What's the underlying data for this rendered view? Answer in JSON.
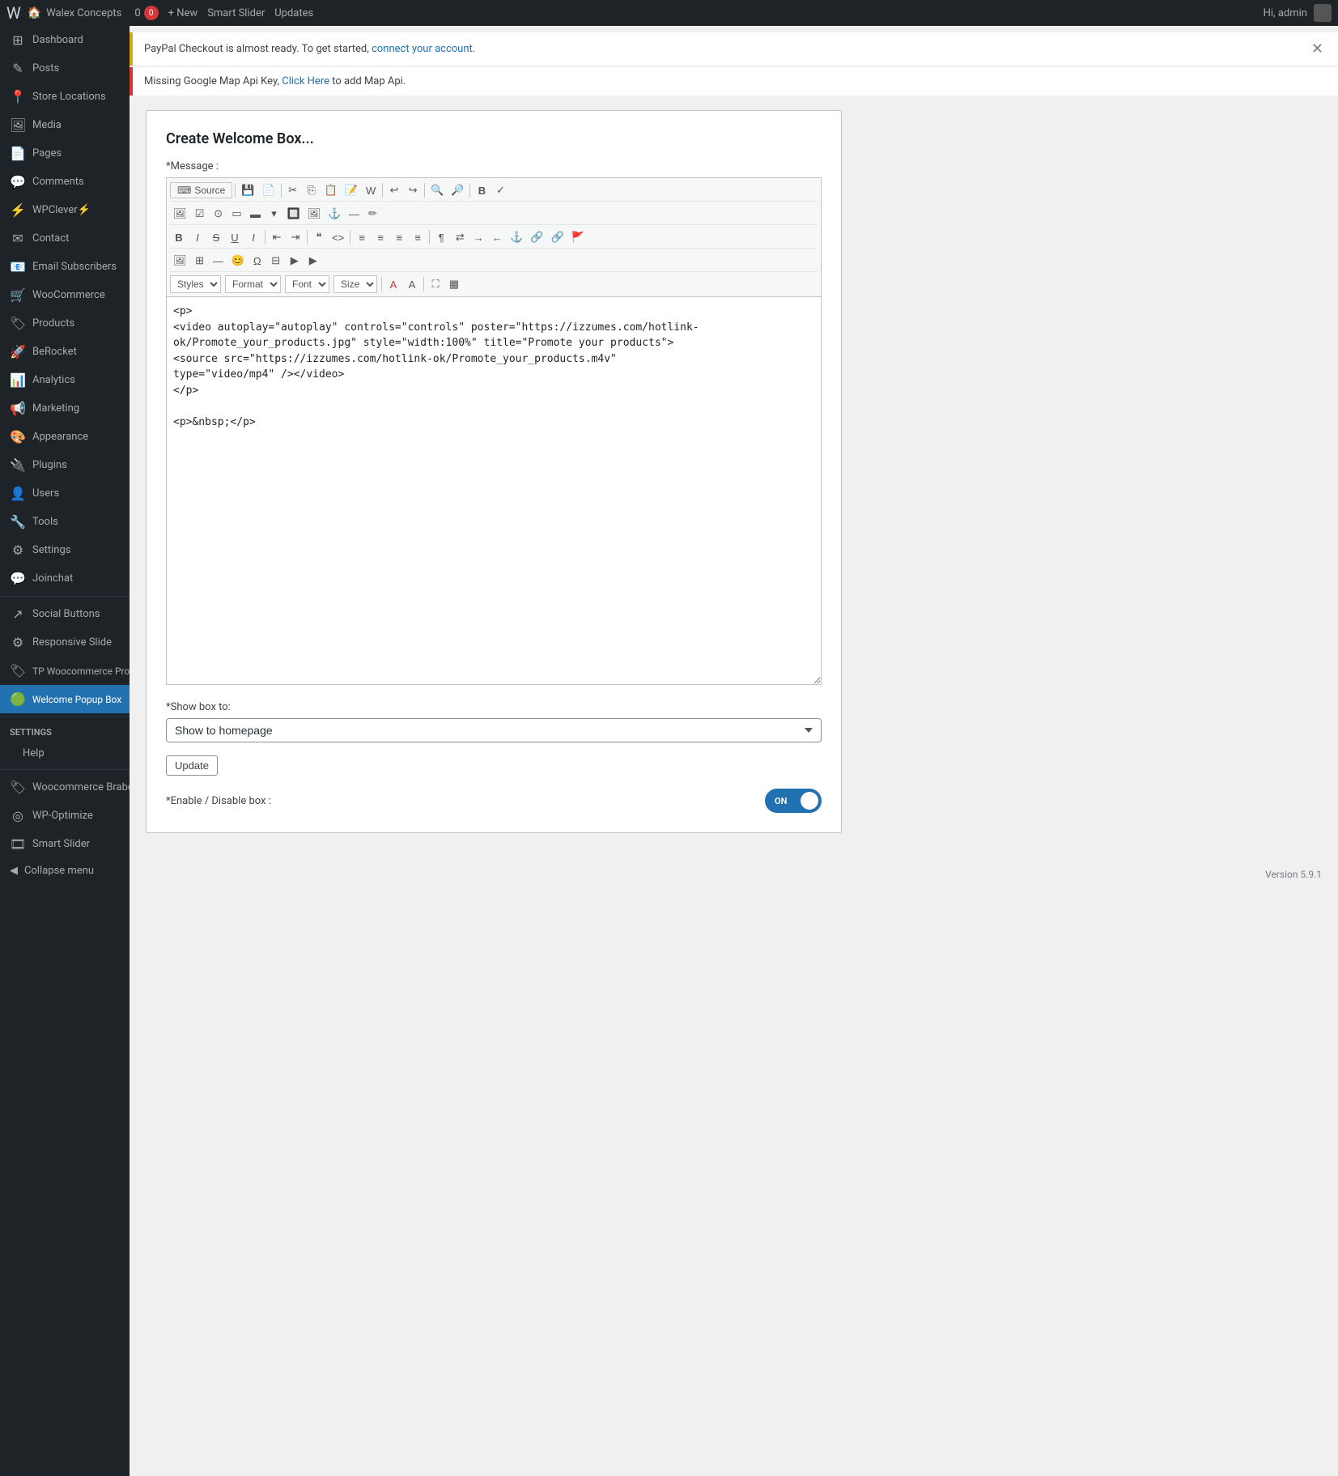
{
  "adminbar": {
    "logo": "W",
    "site_name": "Walex Concepts",
    "notifications_count": "0",
    "new_label": "+ New",
    "plugin_name": "Smart Slider",
    "updates_label": "Updates",
    "greeting": "Hi, admin"
  },
  "sidebar": {
    "items": [
      {
        "id": "dashboard",
        "label": "Dashboard",
        "icon": "⊞"
      },
      {
        "id": "posts",
        "label": "Posts",
        "icon": "✎"
      },
      {
        "id": "store-locations",
        "label": "Store Locations",
        "icon": "📍"
      },
      {
        "id": "media",
        "label": "Media",
        "icon": "🖼"
      },
      {
        "id": "pages",
        "label": "Pages",
        "icon": "📄"
      },
      {
        "id": "comments",
        "label": "Comments",
        "icon": "💬"
      },
      {
        "id": "wpclever",
        "label": "WPClever⚡",
        "icon": "⚡"
      },
      {
        "id": "contact",
        "label": "Contact",
        "icon": "✉"
      },
      {
        "id": "email-subscribers",
        "label": "Email Subscribers",
        "icon": "📧"
      },
      {
        "id": "woocommerce",
        "label": "WooCommerce",
        "icon": "🛒"
      },
      {
        "id": "products",
        "label": "Products",
        "icon": "🏷"
      },
      {
        "id": "berocket",
        "label": "BeRocket",
        "icon": "🚀"
      },
      {
        "id": "analytics",
        "label": "Analytics",
        "icon": "📊"
      },
      {
        "id": "marketing",
        "label": "Marketing",
        "icon": "📢"
      },
      {
        "id": "appearance",
        "label": "Appearance",
        "icon": "🎨"
      },
      {
        "id": "plugins",
        "label": "Plugins",
        "icon": "🔌"
      },
      {
        "id": "users",
        "label": "Users",
        "icon": "👤"
      },
      {
        "id": "tools",
        "label": "Tools",
        "icon": "🔧"
      },
      {
        "id": "settings",
        "label": "Settings",
        "icon": "⚙"
      },
      {
        "id": "joinchat",
        "label": "Joinchat",
        "icon": "💬"
      }
    ],
    "section_settings": {
      "label": "Settings",
      "items": [
        {
          "id": "help",
          "label": "Help"
        },
        {
          "id": "woocommerce-brabd",
          "label": "Woocommerce Brabd"
        },
        {
          "id": "wp-optimize",
          "label": "WP-Optimize"
        },
        {
          "id": "smart-slider",
          "label": "Smart Slider"
        }
      ]
    },
    "submenu_items": [
      {
        "id": "social-buttons",
        "label": "Social Buttons",
        "icon": "↗"
      },
      {
        "id": "responsive-slide",
        "label": "Responsive Slide",
        "icon": "⚙"
      },
      {
        "id": "tp-woocommerce",
        "label": "TP Woocommerce Product Gallery",
        "icon": "🏷"
      },
      {
        "id": "welcome-popup",
        "label": "Welcome Popup Box",
        "icon": "🟢",
        "active": true
      }
    ],
    "collapse_label": "Collapse menu"
  },
  "notices": [
    {
      "id": "paypal-notice",
      "type": "warning",
      "text": "PayPal Checkout is almost ready. To get started,",
      "link_text": "connect your account",
      "link_url": "#",
      "dismissible": true
    },
    {
      "id": "google-map-notice",
      "type": "error",
      "text": "Missing Google Map Api Key,",
      "link_text": "Click Here",
      "link_url": "#",
      "text_after": "to add Map Api.",
      "dismissible": false
    }
  ],
  "form": {
    "title": "Create Welcome Box...",
    "message_label": "*Message :",
    "editor": {
      "source_button": "Source",
      "toolbar_rows": [
        [
          "source",
          "|",
          "save",
          "new-page",
          "|",
          "cut",
          "copy",
          "paste",
          "paste-text",
          "paste-word",
          "|",
          "undo",
          "redo",
          "|",
          "find",
          "find-replace",
          "|",
          "bold-toolbar",
          "spellcheck"
        ],
        [
          "image",
          "checkbox",
          "radio",
          "textfield",
          "textarea",
          "select",
          "button",
          "image-btn",
          "anchor",
          "divider"
        ],
        [
          "bold",
          "italic",
          "strikethrough",
          "underline",
          "italic2",
          "|",
          "decrease-indent",
          "increase-indent",
          "|",
          "blockquote",
          "code",
          "|",
          "align-left",
          "align-center",
          "align-right",
          "align-justify",
          "|",
          "paragraph",
          "bidirection",
          "ltr",
          "rtl",
          "anchor2",
          "link",
          "unlink",
          "flag"
        ],
        [
          "image2",
          "table",
          "horizontal-rule",
          "smiley",
          "special-char",
          "pagebreak",
          "iframe",
          "insert-media"
        ],
        [
          "styles",
          "format",
          "font",
          "size",
          "|",
          "font-color",
          "bg-color",
          "|",
          "maximize",
          "show-blocks"
        ]
      ],
      "styles_options": [
        "Styles"
      ],
      "format_options": [
        "Format"
      ],
      "font_options": [
        "Font"
      ],
      "size_options": [
        "Size"
      ],
      "content": "<p>\n<video autoplay=\"autoplay\" controls=\"controls\" poster=\"https://izzumes.com/hotlink-ok/Promote_your_products.jpg\" style=\"width:100%\" title=\"Promote your products\">\n<source src=\"https://izzumes.com/hotlink-ok/Promote_your_products.m4v\"\ntype=\"video/mp4\" /></video>\n</p>\n\n<p>&nbsp;</p>"
    },
    "show_box_to_label": "*Show box to:",
    "show_box_options": [
      {
        "value": "homepage",
        "label": "Show to homepage"
      }
    ],
    "show_box_selected": "Show to homepage",
    "update_button": "Update",
    "enable_label": "*Enable / Disable box :",
    "toggle_on_text": "ON",
    "toggle_state": true
  },
  "footer": {
    "version": "Version 5.9.1"
  }
}
